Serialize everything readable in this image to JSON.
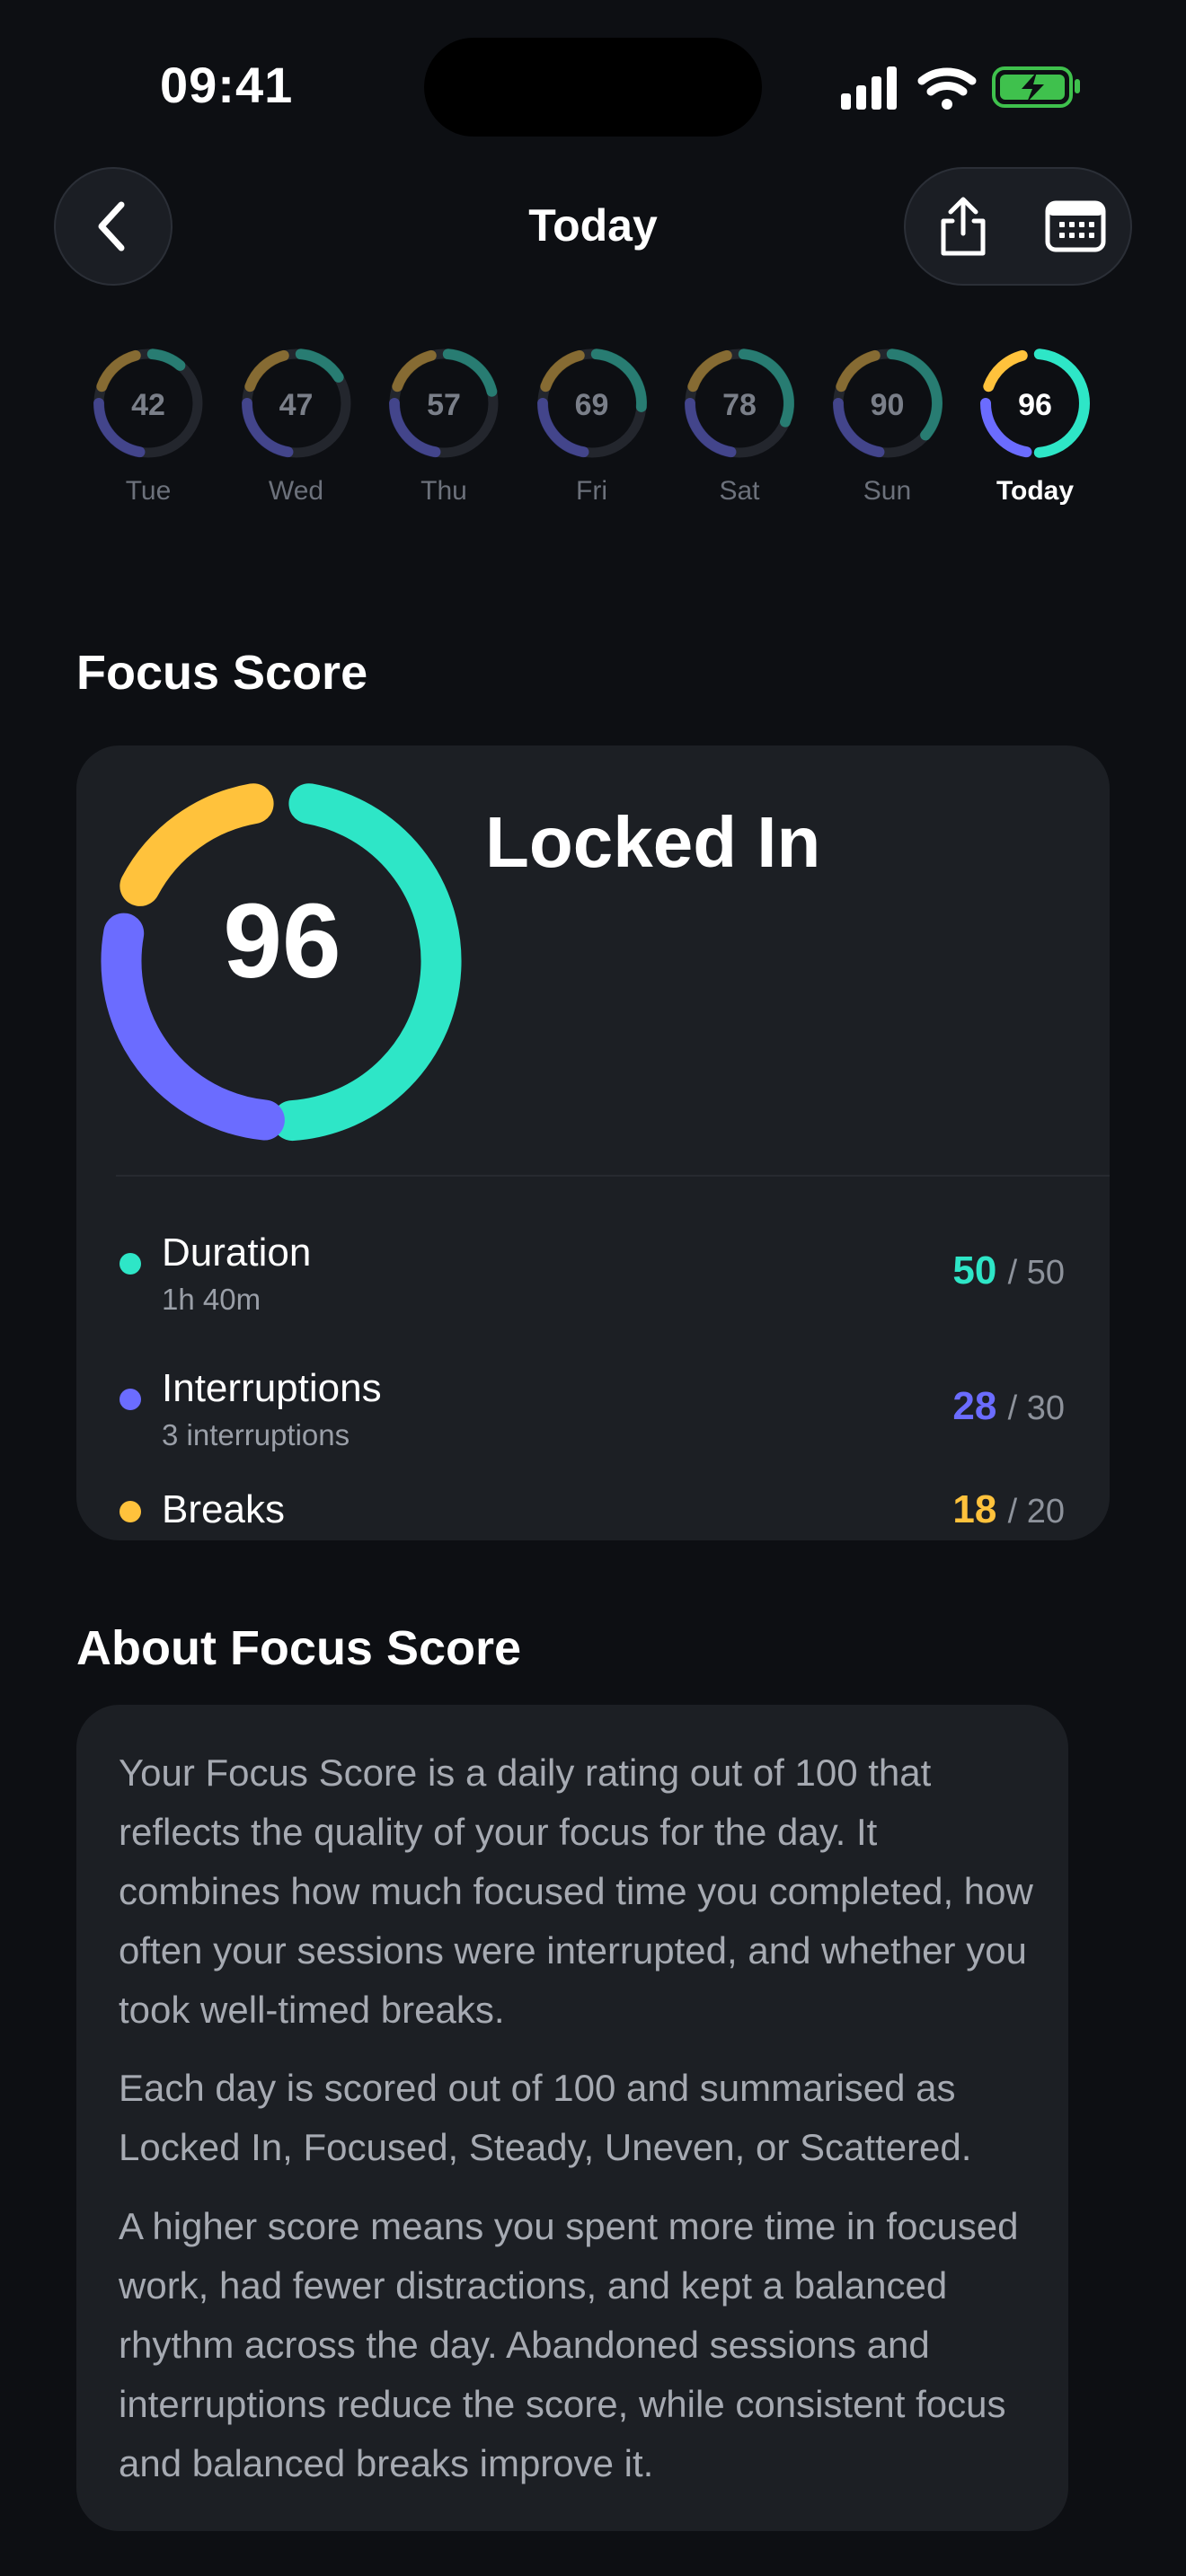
{
  "status_bar": {
    "time": "09:41"
  },
  "nav": {
    "title": "Today"
  },
  "week": [
    {
      "score": "42",
      "label": "Tue",
      "today": false
    },
    {
      "score": "47",
      "label": "Wed",
      "today": false
    },
    {
      "score": "57",
      "label": "Thu",
      "today": false
    },
    {
      "score": "69",
      "label": "Fri",
      "today": false
    },
    {
      "score": "78",
      "label": "Sat",
      "today": false
    },
    {
      "score": "90",
      "label": "Sun",
      "today": false
    },
    {
      "score": "96",
      "label": "Today",
      "today": true
    }
  ],
  "focus": {
    "section_title": "Focus Score",
    "score": "96",
    "status": "Locked In",
    "metrics": [
      {
        "name": "Duration",
        "sub": "1h 40m",
        "score": "50",
        "max": "/ 50",
        "color": "#2ee6c7"
      },
      {
        "name": "Interruptions",
        "sub": "3 interruptions",
        "score": "28",
        "max": "/ 30",
        "color": "#6b6cff"
      },
      {
        "name": "Breaks",
        "sub": "",
        "score": "18",
        "max": "/ 20",
        "color": "#ffc23c"
      }
    ]
  },
  "about": {
    "title": "About Focus Score",
    "paragraphs": [
      "Your Focus Score is a daily rating out of 100 that reflects the quality of your focus for the day. It combines how much focused time you completed, how often your sessions were interrupted, and whether you took well-timed breaks.",
      "Each day is scored out of 100 and summarised as Locked In, Focused, Steady, Uneven, or Scattered.",
      "A higher score means you spent more time in focused work, had fewer distractions, and kept a balanced rhythm across the day. Abandoned sessions and interruptions reduce the score, while consistent focus and balanced breaks improve it."
    ]
  },
  "colors": {
    "duration": "#2ee6c7",
    "interruptions": "#6b6cff",
    "breaks": "#ffc23c",
    "background": "#0d0f13",
    "card": "#1c1f24"
  },
  "icons": [
    "chevron-left-icon",
    "share-icon",
    "calendar-icon",
    "signal-icon",
    "wifi-icon",
    "battery-charging-icon"
  ]
}
